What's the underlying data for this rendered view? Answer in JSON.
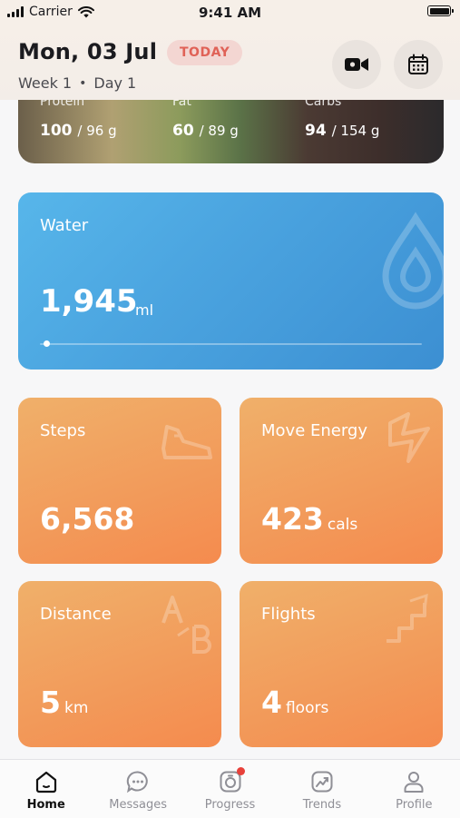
{
  "status_bar": {
    "carrier": "Carrier",
    "time": "9:41 AM"
  },
  "header": {
    "date": "Mon, 03 Jul",
    "today_badge": "TODAY",
    "week": "Week 1",
    "day": "Day 1"
  },
  "macros": [
    {
      "label": "Protein",
      "current": "100",
      "target": "/ 96 g"
    },
    {
      "label": "Fat",
      "current": "60",
      "target": "/ 89 g"
    },
    {
      "label": "Carbs",
      "current": "94",
      "target": "/ 154 g"
    }
  ],
  "water": {
    "title": "Water",
    "amount": "1,945",
    "unit": "ml",
    "progress": 0.01
  },
  "tiles": {
    "steps": {
      "title": "Steps",
      "value": "6,568",
      "unit": ""
    },
    "move_energy": {
      "title": "Move Energy",
      "value": "423",
      "unit": "cals"
    },
    "distance": {
      "title": "Distance",
      "value": "5",
      "unit": "km"
    },
    "flights": {
      "title": "Flights",
      "value": "4",
      "unit": "floors"
    }
  },
  "tabbar": {
    "home": "Home",
    "messages": "Messages",
    "progress": "Progress",
    "trends": "Trends",
    "profile": "Profile"
  },
  "colors": {
    "water": "#4aa3df",
    "tile": "#f29a5a",
    "badge": "#e06257",
    "notification": "#e8413a"
  }
}
